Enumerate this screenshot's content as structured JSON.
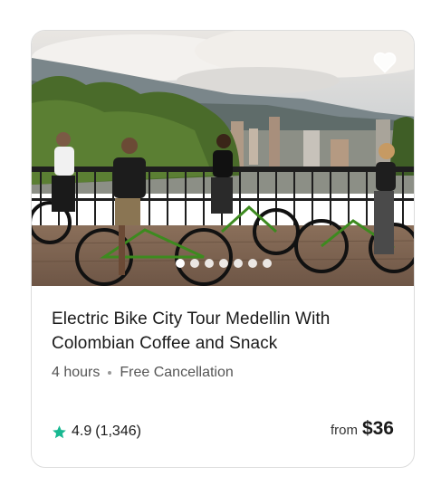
{
  "card": {
    "title": "Electric Bike City Tour Medellin With Colombian Coffee and Snack",
    "duration": "4 hours",
    "cancellation": "Free Cancellation",
    "rating": "4.9",
    "reviews": "(1,346)",
    "price_prefix": "from",
    "price": "$36",
    "carousel_count": 7,
    "carousel_active_index": 0,
    "icons": {
      "wishlist": "heart-icon",
      "rating": "star-icon"
    },
    "colors": {
      "star": "#18b891",
      "text": "#1a1a1a",
      "muted": "#555555"
    }
  }
}
